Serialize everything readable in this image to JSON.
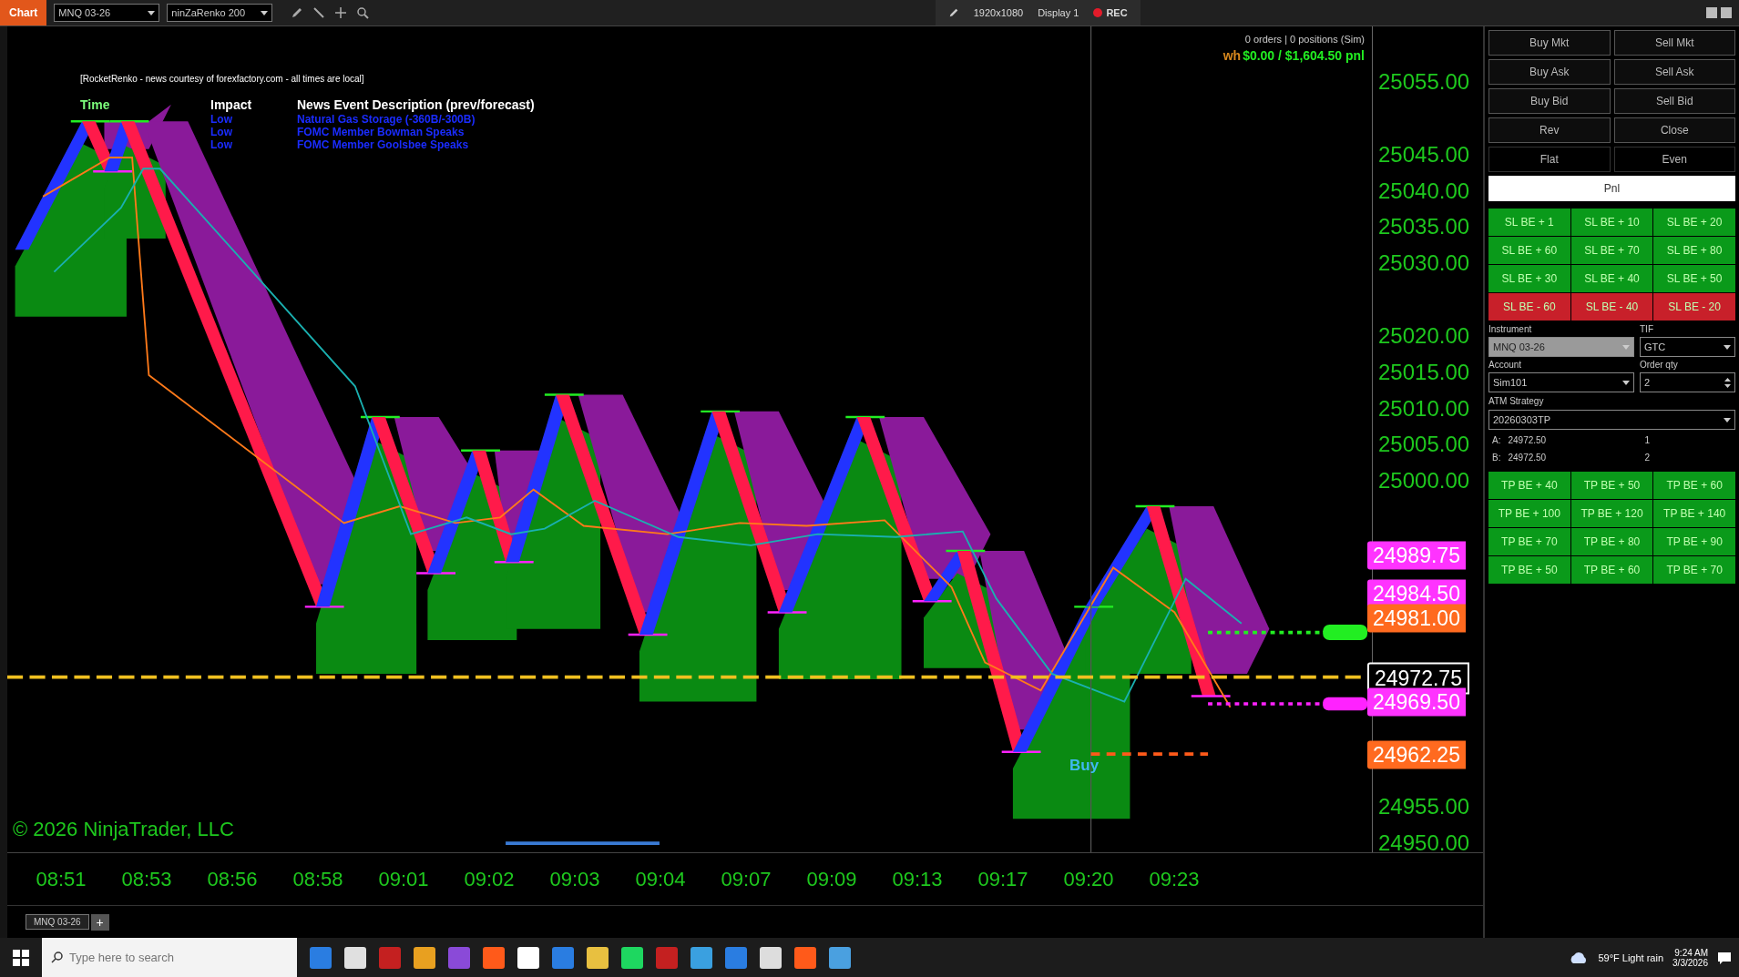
{
  "toolbar": {
    "tab": "Chart",
    "instrument": "MNQ 03-26",
    "bar_type": "ninZaRenko 200",
    "resolution": "1920x1080",
    "display": "Display 1",
    "rec": "REC"
  },
  "chart": {
    "news": {
      "title": "[RocketRenko - news courtesy of forexfactory.com - all times are local]",
      "headers": [
        "Time",
        "Impact",
        "News Event Description (prev/forecast)"
      ],
      "rows": [
        {
          "impact": "Low",
          "description": "Natural Gas Storage (-360B/-300B)"
        },
        {
          "impact": "Low",
          "description": "FOMC Member Bowman Speaks"
        },
        {
          "impact": "Low",
          "description": "FOMC Member Goolsbee Speaks"
        }
      ]
    },
    "account_status": "0 orders | 0 positions (Sim)",
    "pnl_prefix": "wh",
    "pnl": "$0.00 / $1,604.50 pnl",
    "copyright": "© 2026 NinjaTrader, LLC",
    "signal": "Buy",
    "price_ticks": [
      "25055.00",
      "25045.00",
      "25040.00",
      "25035.00",
      "25030.00",
      "25020.00",
      "25015.00",
      "25010.00",
      "25005.00",
      "25000.00",
      "24955.00",
      "24950.00"
    ],
    "price_markers": [
      {
        "text": "24989.75",
        "kind": "marker",
        "color": "#ff33ff"
      },
      {
        "text": "24984.50",
        "kind": "marker",
        "color": "#ff33ff"
      },
      {
        "text": "24981.00",
        "kind": "marker",
        "color": "#ff6a1f"
      },
      {
        "text": "24972.75",
        "kind": "last",
        "color": "#000000"
      },
      {
        "text": "24969.50",
        "kind": "marker",
        "color": "#ff33ff"
      },
      {
        "text": "24962.25",
        "kind": "marker",
        "color": "#ff6a1f"
      }
    ],
    "time_ticks": [
      "08:51",
      "08:53",
      "08:56",
      "08:58",
      "09:01",
      "09:02",
      "09:03",
      "09:04",
      "09:07",
      "09:09",
      "09:13",
      "09:17",
      "09:20",
      "09:23"
    ]
  },
  "chart_tab": {
    "label": "MNQ 03-26",
    "add": "+"
  },
  "order_panel": {
    "buttons": [
      [
        "Buy Mkt",
        "Sell Mkt"
      ],
      [
        "Buy Ask",
        "Sell Ask"
      ],
      [
        "Buy Bid",
        "Sell Bid"
      ],
      [
        "Rev",
        "Close"
      ]
    ],
    "flat_row": [
      "Flat",
      "Even"
    ],
    "pnl_button": "Pnl",
    "sl_buttons": [
      {
        "label": "SL BE + 1",
        "color": "#0a9a1a"
      },
      {
        "label": "SL BE + 10",
        "color": "#0a9a1a"
      },
      {
        "label": "SL BE + 20",
        "color": "#0a9a1a"
      },
      {
        "label": "SL BE + 60",
        "color": "#0a9a1a"
      },
      {
        "label": "SL BE + 70",
        "color": "#0a9a1a"
      },
      {
        "label": "SL BE + 80",
        "color": "#0a9a1a"
      },
      {
        "label": "SL BE + 30",
        "color": "#0a9a1a"
      },
      {
        "label": "SL BE + 40",
        "color": "#0a9a1a"
      },
      {
        "label": "SL BE + 50",
        "color": "#0a9a1a"
      },
      {
        "label": "SL BE - 60",
        "color": "#c8202a"
      },
      {
        "label": "SL BE - 40",
        "color": "#c8202a"
      },
      {
        "label": "SL BE - 20",
        "color": "#c8202a"
      }
    ],
    "fields": [
      {
        "label": "Instrument",
        "value": "MNQ 03-26",
        "kind": "select",
        "disabled": true
      },
      {
        "label": "TIF",
        "value": "GTC",
        "kind": "select",
        "disabled": false
      },
      {
        "label": "Account",
        "value": "Sim101",
        "kind": "select",
        "disabled": false
      },
      {
        "label": "Order qty",
        "value": "2",
        "kind": "spin",
        "disabled": false
      }
    ],
    "atm": {
      "label": "ATM Strategy",
      "value": "20260303TP"
    },
    "targets": [
      {
        "name": "A:",
        "price": "24972.50",
        "qty": "1"
      },
      {
        "name": "B:",
        "price": "24972.50",
        "qty": "2"
      }
    ],
    "tp_buttons": [
      "TP BE + 40",
      "TP BE + 50",
      "TP BE + 60",
      "TP BE + 100",
      "TP BE + 120",
      "TP BE + 140",
      "TP BE + 70",
      "TP BE + 80",
      "TP BE + 90",
      "TP BE + 50",
      "TP BE + 60",
      "TP BE + 70"
    ]
  },
  "taskbar": {
    "search_placeholder": "Type here to search",
    "weather": "59°F  Light rain",
    "time": "9:24 AM",
    "date": "3/3/2026"
  }
}
